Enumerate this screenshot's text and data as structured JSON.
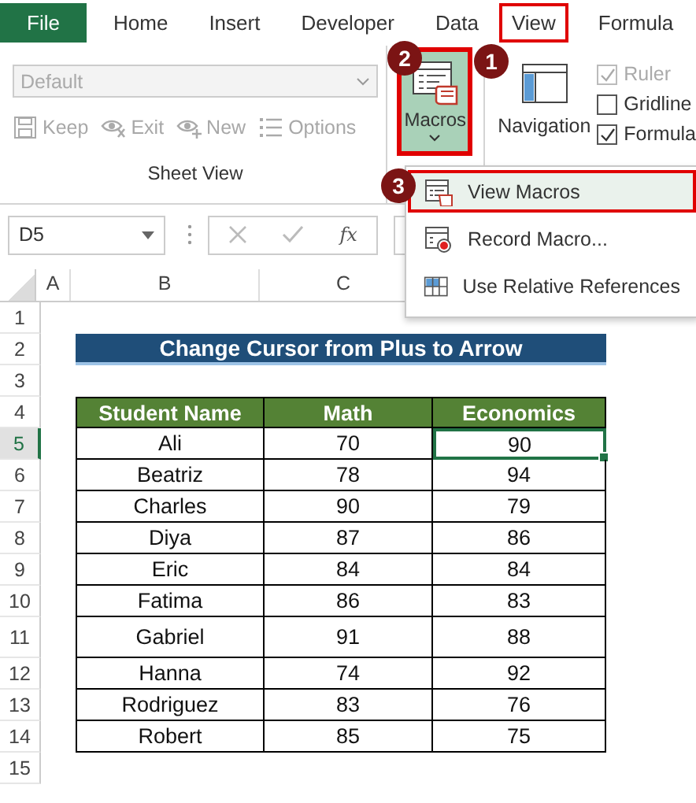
{
  "tabs": [
    {
      "label": "File",
      "kind": "file",
      "selected": false
    },
    {
      "label": "Home",
      "kind": "tab",
      "selected": false
    },
    {
      "label": "Insert",
      "kind": "tab",
      "selected": false
    },
    {
      "label": "Developer",
      "kind": "tab",
      "selected": false
    },
    {
      "label": "Data",
      "kind": "tab",
      "selected": false
    },
    {
      "label": "View",
      "kind": "tab",
      "selected": true
    },
    {
      "label": "Formula",
      "kind": "tab",
      "selected": false
    }
  ],
  "ribbon": {
    "sheet_view": {
      "dropdown": {
        "value": "Default",
        "disabled": true
      },
      "buttons": [
        {
          "label": "Keep",
          "kind": "keep",
          "disabled": true
        },
        {
          "label": "Exit",
          "kind": "exit",
          "disabled": true
        },
        {
          "label": "New",
          "kind": "new",
          "disabled": true
        },
        {
          "label": "Options",
          "kind": "options",
          "disabled": true
        }
      ],
      "group_label": "Sheet View"
    },
    "macros": {
      "label": "Macros",
      "selected": true
    },
    "navigation": {
      "label": "Navigation"
    },
    "options": [
      {
        "label": "Ruler",
        "checked": true,
        "disabled": true
      },
      {
        "label": "Gridline",
        "checked": false,
        "disabled": false
      },
      {
        "label": "Formula",
        "checked": true,
        "disabled": false
      }
    ]
  },
  "menu": {
    "items": [
      {
        "label": "View Macros",
        "kind": "view",
        "selected": true
      },
      {
        "label": "Record Macro...",
        "kind": "record",
        "selected": false
      },
      {
        "label": "Use Relative References",
        "kind": "relative",
        "selected": false
      }
    ]
  },
  "steps": [
    "1",
    "2",
    "3"
  ],
  "formula_bar": {
    "name_box": "D5",
    "function_label": "fx"
  },
  "sheet": {
    "columns": [
      "A",
      "B",
      "C"
    ],
    "row_numbers": [
      "1",
      "2",
      "3",
      "4",
      "5",
      "6",
      "7",
      "8",
      "9",
      "10",
      "11",
      "12",
      "13",
      "14",
      "15"
    ],
    "title": "Change Cursor from Plus to Arrow",
    "table": {
      "columns": [
        "Student Name",
        "Math",
        "Economics"
      ],
      "rows": [
        {
          "cells": [
            {
              "text": "Ali",
              "selected": false
            },
            {
              "text": "70",
              "selected": false
            },
            {
              "text": "90",
              "selected": true
            }
          ]
        },
        {
          "cells": [
            {
              "text": "Beatriz",
              "selected": false
            },
            {
              "text": "78",
              "selected": false
            },
            {
              "text": "94",
              "selected": false
            }
          ]
        },
        {
          "cells": [
            {
              "text": "Charles",
              "selected": false
            },
            {
              "text": "90",
              "selected": false
            },
            {
              "text": "79",
              "selected": false
            }
          ]
        },
        {
          "cells": [
            {
              "text": "Diya",
              "selected": false
            },
            {
              "text": "87",
              "selected": false
            },
            {
              "text": "86",
              "selected": false
            }
          ]
        },
        {
          "cells": [
            {
              "text": "Eric",
              "selected": false
            },
            {
              "text": "84",
              "selected": false
            },
            {
              "text": "84",
              "selected": false
            }
          ]
        },
        {
          "cells": [
            {
              "text": "Fatima",
              "selected": false
            },
            {
              "text": "86",
              "selected": false
            },
            {
              "text": "83",
              "selected": false
            }
          ]
        },
        {
          "cells": [
            {
              "text": "Gabriel",
              "selected": false
            },
            {
              "text": "91",
              "selected": false
            },
            {
              "text": "88",
              "selected": false
            }
          ]
        },
        {
          "cells": [
            {
              "text": "Hanna",
              "selected": false
            },
            {
              "text": "74",
              "selected": false
            },
            {
              "text": "92",
              "selected": false
            }
          ]
        },
        {
          "cells": [
            {
              "text": "Rodriguez",
              "selected": false
            },
            {
              "text": "83",
              "selected": false
            },
            {
              "text": "76",
              "selected": false
            }
          ]
        },
        {
          "cells": [
            {
              "text": "Robert",
              "selected": false
            },
            {
              "text": "85",
              "selected": false
            },
            {
              "text": "75",
              "selected": false
            }
          ]
        }
      ]
    }
  }
}
